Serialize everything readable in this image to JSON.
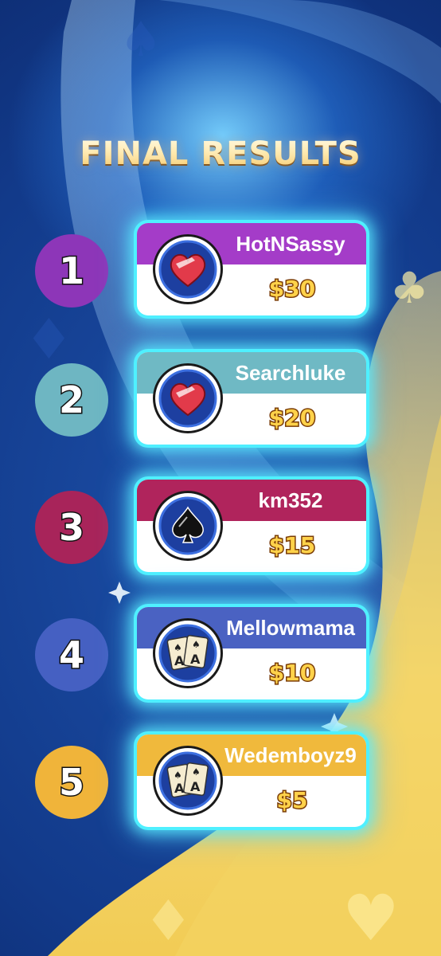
{
  "screen": {
    "title": "FINAL RESULTS"
  },
  "results": [
    {
      "rank": "1",
      "name": "HotNSassy",
      "prize": "$30",
      "avatar": "heart-icon",
      "color": "#a43cc8",
      "badge_color": "#8d36b8"
    },
    {
      "rank": "2",
      "name": "Searchluke",
      "prize": "$20",
      "avatar": "heart-icon",
      "color": "#6fb9c4",
      "badge_color": "#6eb6c2"
    },
    {
      "rank": "3",
      "name": "km352",
      "prize": "$15",
      "avatar": "spade-icon",
      "color": "#b0245c",
      "badge_color": "#a8245a"
    },
    {
      "rank": "4",
      "name": "Mellowmama",
      "prize": "$10",
      "avatar": "aces-cards-icon",
      "color": "#4a62c2",
      "badge_color": "#4560c2"
    },
    {
      "rank": "5",
      "name": "Wedemboyz9",
      "prize": "$5",
      "avatar": "aces-cards-icon",
      "color": "#f0b93c",
      "badge_color": "#f0b43a"
    }
  ]
}
